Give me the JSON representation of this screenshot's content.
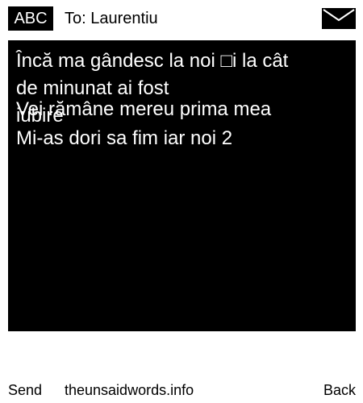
{
  "header": {
    "mode_label": "ABC",
    "recipient": "To: Laurentiu",
    "envelope_icon": "envelope-icon"
  },
  "message": {
    "lines": [
      "Încă ma gândesc la noi □i la cât",
      "de minunat ai fost",
      "iubire",
      "Vei rămâne mereu prima mea",
      "Mi-as dori sa fim iar noi 2"
    ]
  },
  "footer": {
    "send_label": "Send",
    "site_label": "theunsaidwords.info",
    "back_label": "Back"
  },
  "colors": {
    "background": "#ffffff",
    "screen": "#000000",
    "text_on_screen": "#ffffff",
    "text": "#000000"
  }
}
